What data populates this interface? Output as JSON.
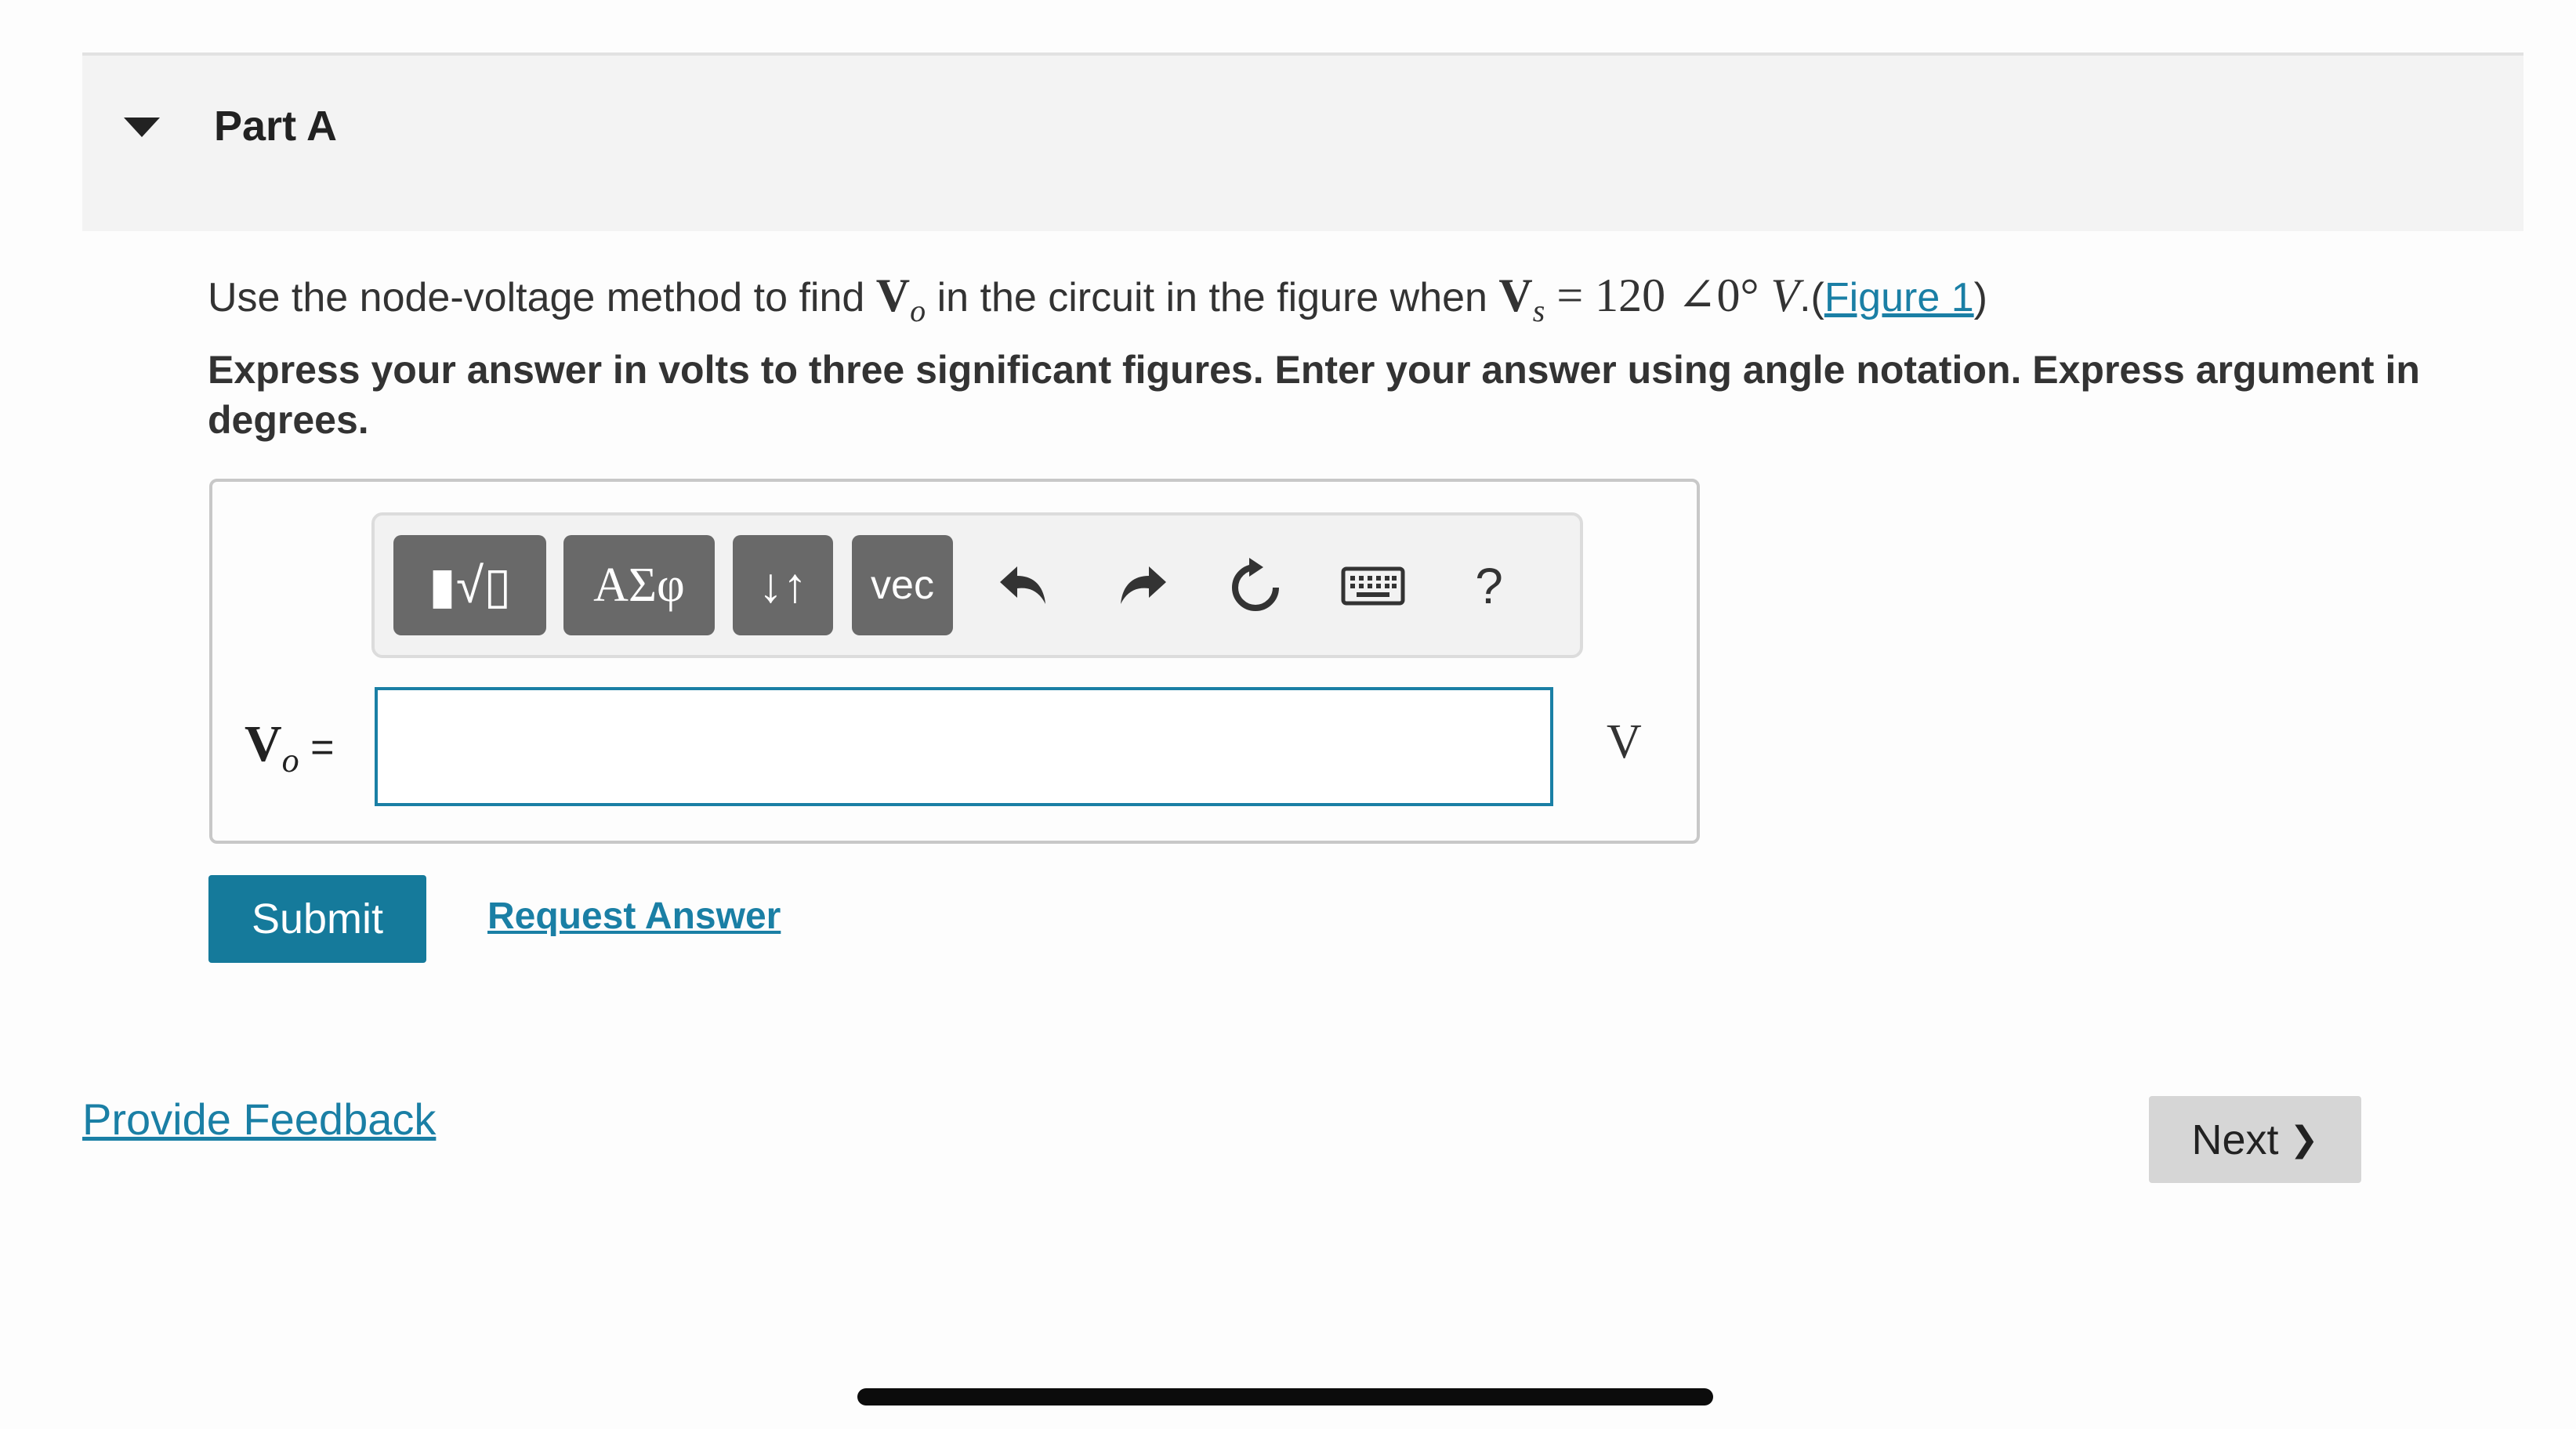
{
  "part": {
    "title": "Part A"
  },
  "question": {
    "text_before": "Use the node-voltage method to find ",
    "vo_symbol": "V",
    "vo_subscript": "o",
    "text_middle": " in the circuit in the figure when ",
    "vs_symbol": "V",
    "vs_subscript": "s",
    "vs_value": " = 120 ∠0° ",
    "vs_unit": "V",
    "period_paren": ".(",
    "figure_link": "Figure 1",
    "close_paren": ")"
  },
  "instructions": "Express your answer in volts to three significant figures. Enter your answer using angle notation. Express argument in degrees.",
  "toolbar": {
    "templates_label": "▮√▯",
    "greek_label": "ΑΣφ",
    "arrows_label": "↓↑",
    "vec_label": "vec",
    "undo_glyph": "↶",
    "redo_glyph": "↷",
    "reset_glyph": "↻",
    "keyboard_glyph": "⌨",
    "help_label": "?"
  },
  "answer": {
    "var_symbol": "V",
    "var_subscript": "o",
    "equals": " =",
    "value": "",
    "unit": "V"
  },
  "actions": {
    "submit_label": "Submit",
    "request_answer_label": "Request Answer",
    "feedback_label": "Provide Feedback",
    "next_label": "Next",
    "next_chevron": "❯"
  },
  "colors": {
    "accent": "#157a9b",
    "link": "#1a7fa5",
    "toolbar_button": "#696969",
    "next_bg": "#d6d6d6"
  }
}
